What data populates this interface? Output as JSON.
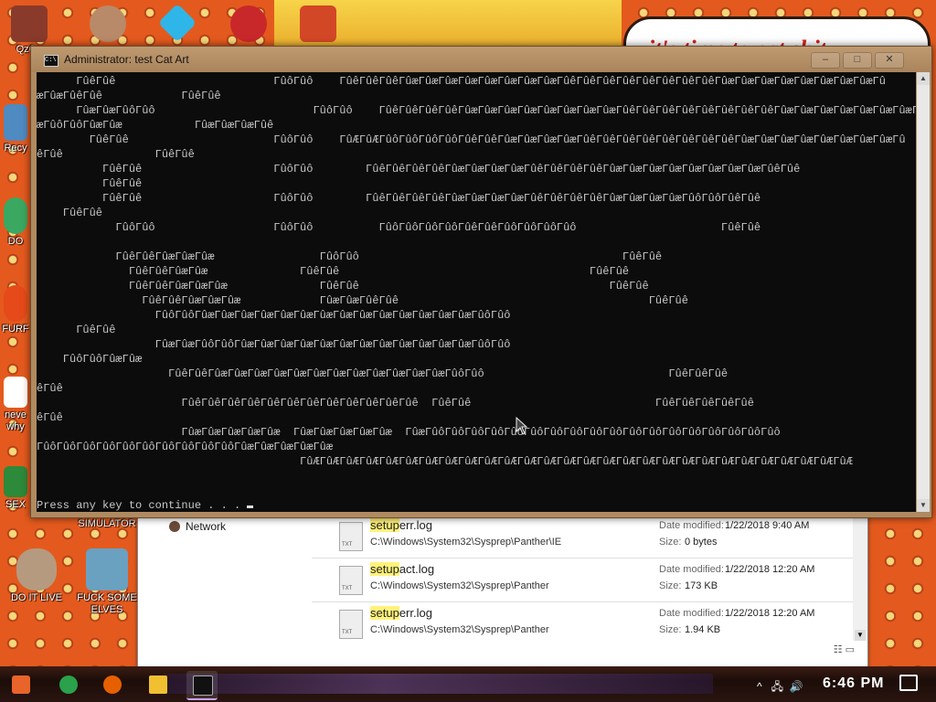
{
  "desktop": {
    "icons": [
      {
        "id": "qzqe",
        "label": "QzQe"
      },
      {
        "id": "recycle",
        "label": "Recy"
      },
      {
        "id": "do",
        "label": "DO"
      },
      {
        "id": "furf",
        "label": "FURF"
      },
      {
        "id": "never",
        "label": "neve\nwhy"
      },
      {
        "id": "sex",
        "label": "SEX"
      },
      {
        "id": "simulator",
        "label": "SIMULATOR"
      },
      {
        "id": "do-it-live",
        "label": "DO IT LIVE"
      },
      {
        "id": "elves",
        "label": "FUCK SOME\nELVES"
      }
    ],
    "wallpaper_text": "it's time to eat shit"
  },
  "console": {
    "title": "Administrator:  test Cat Art",
    "buttons": {
      "minimize": "–",
      "maximize": "□",
      "close": "✕"
    },
    "lines": [
      "      ΓûêΓûê                        ΓûôΓûô    ΓûêΓûêΓûêΓûæΓûæΓûæΓûæΓûæΓûæΓûæΓûæΓûêΓûêΓûêΓûêΓûêΓûêΓûêΓûêΓûæΓûæΓûæΓûæΓûæΓûæΓûæΓûæΓû",
      "æΓûæΓûêΓûê            ΓûêΓûê",
      "      ΓûæΓûæΓûôΓûô                        ΓûôΓûô    ΓûêΓûêΓûêΓûêΓûæΓûæΓûæΓûæΓûæΓûæΓûæΓûæΓûêΓûêΓûêΓûêΓûêΓûêΓûêΓûêΓûæΓûæΓûæΓûæΓûæΓûæΓûæΓû",
      "æΓûôΓûôΓûæΓûæ           ΓûæΓûæΓûæΓûê",
      "        ΓûêΓûê                      ΓûôΓûô    ΓûÆΓûÆΓûôΓûôΓûôΓûôΓûêΓûêΓûæΓûæΓûæΓûæΓûêΓûêΓûêΓûêΓûêΓûêΓûêΓûêΓûæΓûæΓûæΓûæΓûæΓûæΓûæΓûæΓû",
      "êΓûê              ΓûêΓûê",
      "          ΓûêΓûê                    ΓûôΓûô        ΓûêΓûêΓûêΓûêΓûæΓûæΓûæΓûæΓûêΓûêΓûêΓûêΓûæΓûæΓûæΓûæΓûæΓûæΓûæΓûæΓûêΓûê",
      "          ΓûêΓûê",
      "          ΓûêΓûê                    ΓûôΓûô        ΓûêΓûêΓûêΓûêΓûæΓûæΓûæΓûæΓûêΓûêΓûêΓûêΓûæΓûæΓûæΓûæΓûôΓûôΓûêΓûê",
      "    ΓûêΓûê",
      "            ΓûôΓûô                  ΓûôΓûô          ΓûôΓûôΓûôΓûôΓûêΓûêΓûôΓûôΓûôΓûô                      ΓûêΓûê",
      "",
      "            ΓûêΓûêΓûæΓûæΓûæ                ΓûôΓûô                                        ΓûêΓûê",
      "              ΓûêΓûêΓûæΓûæ              ΓûêΓûê                                      ΓûêΓûê",
      "              ΓûêΓûêΓûæΓûæΓûæ              ΓûêΓûê                                      ΓûêΓûê",
      "                ΓûêΓûêΓûæΓûæΓûæ            ΓûæΓûæΓûêΓûê                                      ΓûêΓûê",
      "                  ΓûôΓûôΓûæΓûæΓûæΓûæΓûæΓûæΓûæΓûæΓûæΓûæΓûæΓûæΓûæΓûæΓûôΓûô",
      "      ΓûêΓûê",
      "                  ΓûæΓûæΓûôΓûôΓûæΓûæΓûæΓûæΓûæΓûæΓûæΓûæΓûæΓûæΓûæΓûæΓûôΓûô",
      "    ΓûôΓûôΓûæΓûæ",
      "                    ΓûêΓûêΓûæΓûæΓûæΓûæΓûæΓûæΓûæΓûæΓûæΓûæΓûæΓûæΓûôΓûô                            ΓûêΓûêΓûê",
      "êΓûê",
      "                      ΓûêΓûêΓûêΓûêΓûêΓûêΓûêΓûêΓûêΓûêΓûêΓûê  ΓûêΓûê                            ΓûêΓûêΓûêΓûêΓûê",
      "êΓûê",
      "                      ΓûæΓûæΓûæΓûæΓûæ  ΓûæΓûæΓûæΓûæΓûæ  ΓûæΓûôΓûôΓûôΓûôΓûôΓûôΓûôΓûôΓûôΓûôΓûôΓûôΓûôΓûôΓûôΓûôΓûôΓûô",
      "ΓûôΓûôΓûôΓûôΓûôΓûôΓûôΓûôΓûôΓûôΓûæΓûæΓûæΓûæΓûæ",
      "                                        ΓûÆΓûÆΓûÆΓûÆΓûÆΓûÆΓûÆΓûÆΓûÆΓûÆΓûÆΓûÆΓûÆΓûÆΓûÆΓûÆΓûÆΓûÆΓûÆΓûÆΓûÆΓûÆΓûÆΓûÆΓûÆΓûÆΓûÆΓûÆ",
      "",
      "",
      "Press any key to continue . . . "
    ]
  },
  "explorer": {
    "nav_item": "Network",
    "files": [
      {
        "match": "setup",
        "rest": "err.log",
        "path": "C:\\Windows\\System32\\Sysprep\\Panther\\IE",
        "date_label": "Date modified:",
        "date": "1/22/2018 9:40 AM",
        "size_label": "Size:",
        "size": "0 bytes"
      },
      {
        "match": "setup",
        "rest": "act.log",
        "path": "C:\\Windows\\System32\\Sysprep\\Panther",
        "date_label": "Date modified:",
        "date": "1/22/2018 12:20 AM",
        "size_label": "Size:",
        "size": "173 KB"
      },
      {
        "match": "setup",
        "rest": "err.log",
        "path": "C:\\Windows\\System32\\Sysprep\\Panther",
        "date_label": "Date modified:",
        "date": "1/22/2018 12:20 AM",
        "size_label": "Size:",
        "size": "1.94 KB"
      }
    ]
  },
  "taskbar": {
    "apps": [
      {
        "name": "start",
        "color": "#e8642a"
      },
      {
        "name": "chrome",
        "color": "#2aa14a"
      },
      {
        "name": "firefox",
        "color": "#e66000"
      },
      {
        "name": "file-explorer",
        "color": "#f0c030"
      },
      {
        "name": "command-prompt",
        "color": "#111111"
      }
    ],
    "time": "6:46 PM"
  }
}
